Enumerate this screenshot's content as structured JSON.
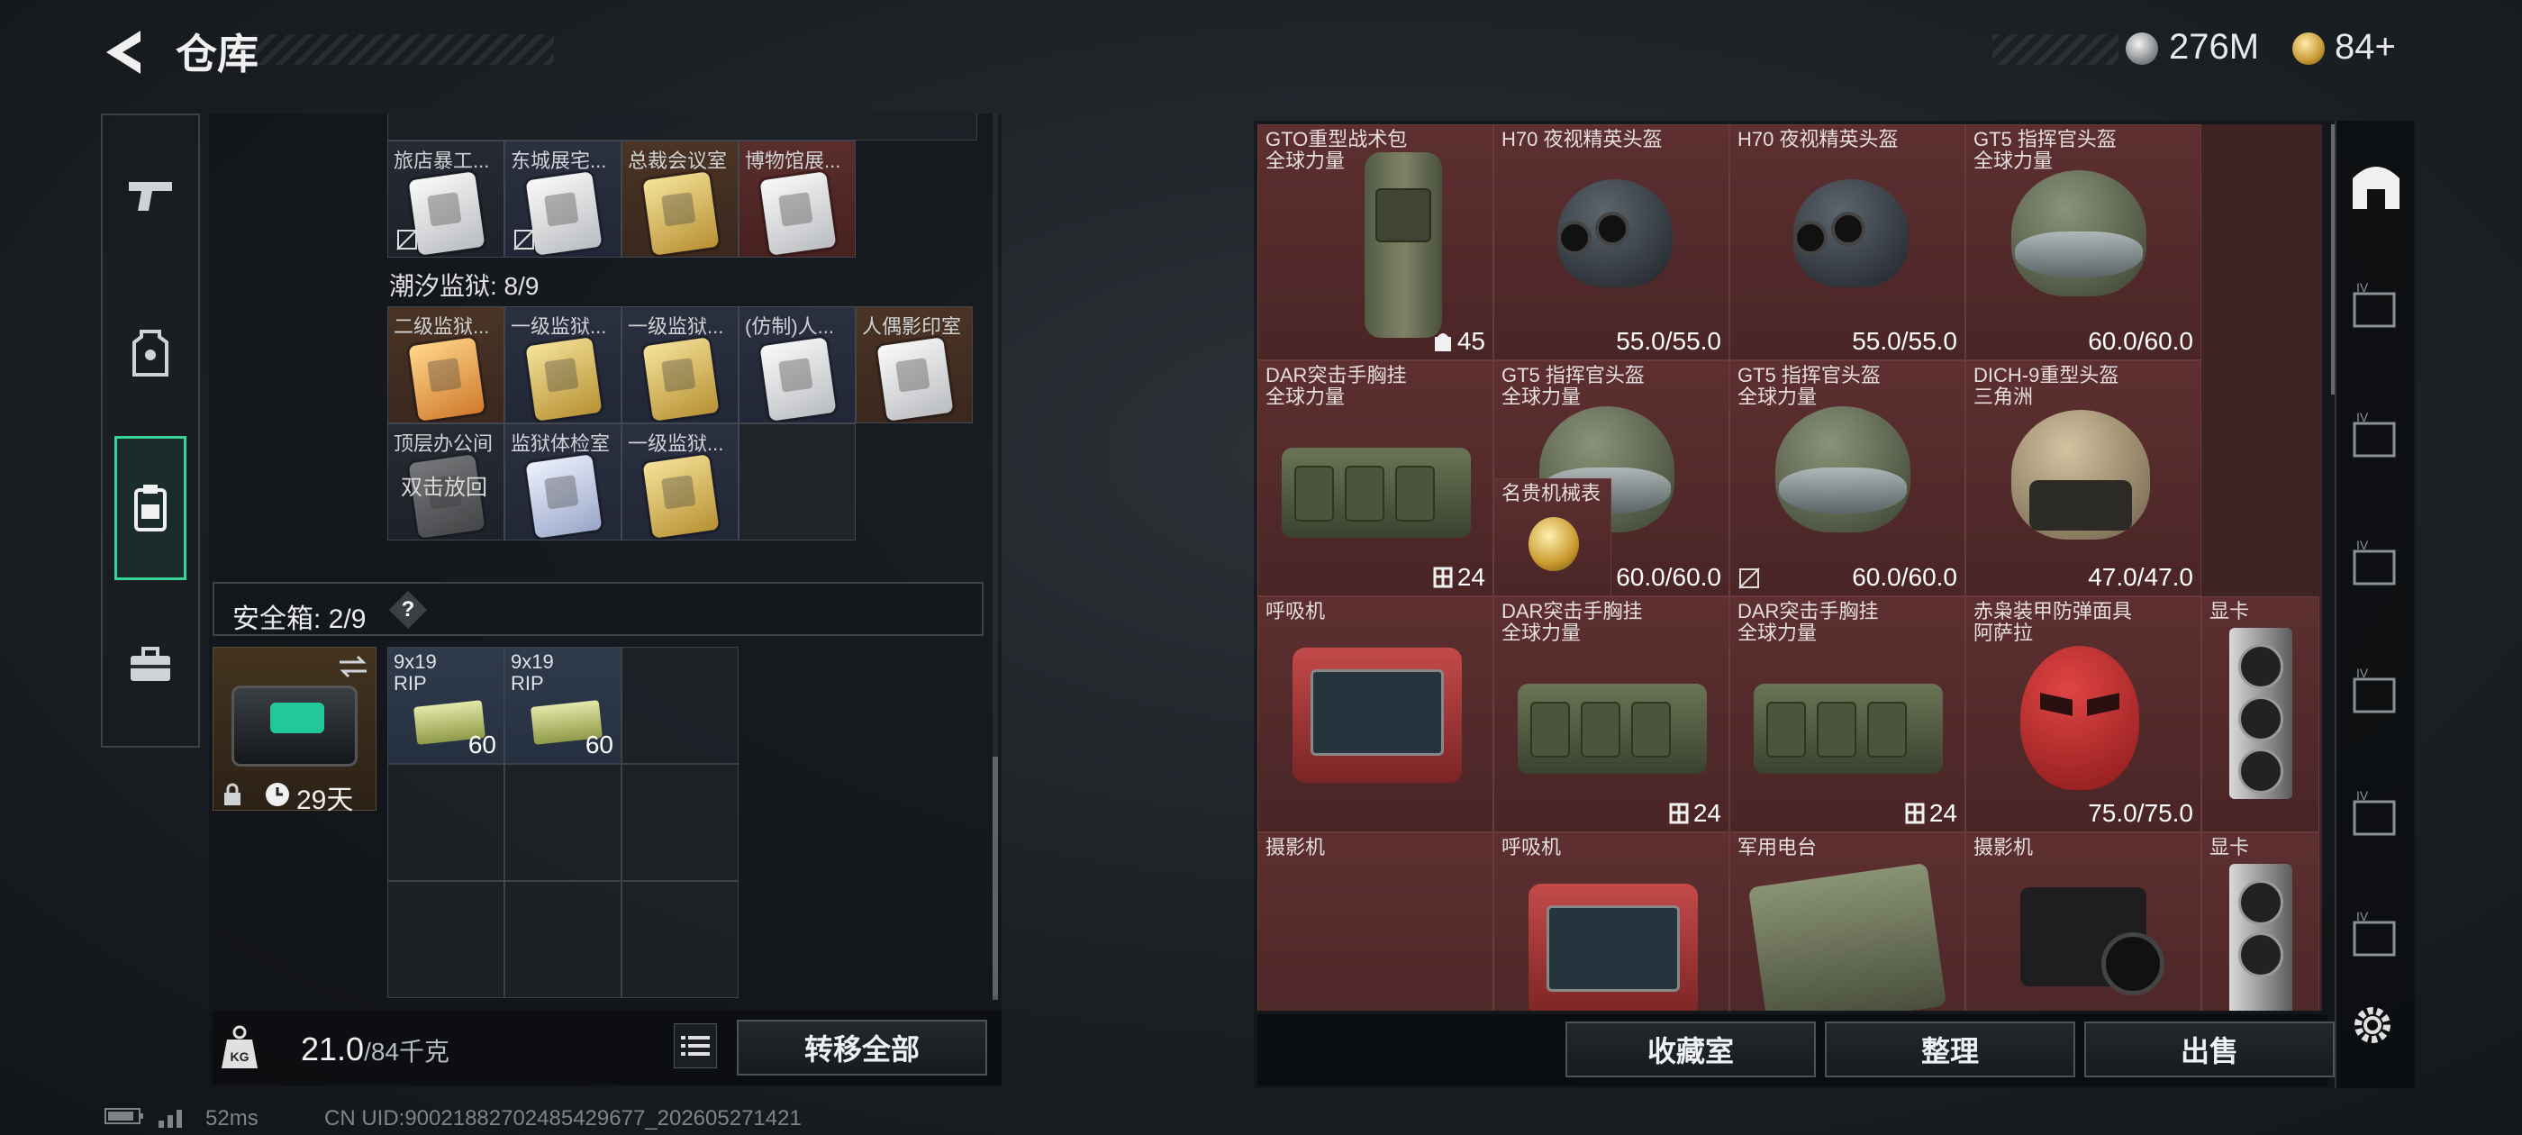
{
  "header": {
    "title": "仓库",
    "currency_silver": "276M",
    "currency_gold": "84+"
  },
  "collection": {
    "row1": [
      {
        "name": "旅店暴工..."
      },
      {
        "name": "东城展宅..."
      },
      {
        "name": "总裁会议室"
      },
      {
        "name": "博物馆展..."
      }
    ],
    "prison_label": "潮汐监狱: 8/9",
    "prison_row1": [
      {
        "name": "二级监狱..."
      },
      {
        "name": "一级监狱..."
      },
      {
        "name": "一级监狱..."
      },
      {
        "name": "(仿制)人..."
      },
      {
        "name": "人偶影印室"
      }
    ],
    "prison_row2": [
      {
        "name": "顶层办公间",
        "hint": "双击放回"
      },
      {
        "name": "监狱体检室"
      },
      {
        "name": "一级监狱..."
      }
    ]
  },
  "safe": {
    "label": "安全箱: 2/9",
    "help": "?",
    "days": "29天",
    "ammo": [
      {
        "name": "9x19\nRIP",
        "count": "60"
      },
      {
        "name": "9x19\nRIP",
        "count": "60"
      }
    ]
  },
  "weight": {
    "current": "21.0",
    "max": "/84千克"
  },
  "buttons": {
    "transfer_all": "转移全部",
    "collection_room": "收藏室",
    "organize": "整理",
    "sell": "出售"
  },
  "items": {
    "gto_bag": {
      "name": "GTO重型战术包",
      "sub": "全球力量",
      "cap": "45"
    },
    "h70_a": {
      "name": "H70 夜视精英头盔",
      "dur": "55.0/55.0"
    },
    "h70_b": {
      "name": "H70 夜视精英头盔",
      "dur": "55.0/55.0"
    },
    "gt5_a": {
      "name": "GT5 指挥官头盔",
      "sub": "全球力量",
      "dur": "60.0/60.0"
    },
    "gt5_b": {
      "name": "GT5 指挥官头盔",
      "sub": "全球力量",
      "dur": "60.0/60.0"
    },
    "gt5_c": {
      "name": "GT5 指挥官头盔",
      "sub": "全球力量",
      "dur": "60.0/60.0"
    },
    "dich9": {
      "name": "DICH-9重型头盔",
      "sub": "三角洲",
      "dur": "47.0/47.0"
    },
    "dar_a": {
      "name": "DAR突击手胸挂",
      "sub": "全球力量",
      "cap": "24"
    },
    "watch": {
      "name": "名贵机械表"
    },
    "dar_b": {
      "name": "DAR突击手胸挂",
      "sub": "全球力量",
      "cap": "24"
    },
    "dar_c": {
      "name": "DAR突击手胸挂",
      "sub": "全球力量",
      "cap": "24"
    },
    "red_mask": {
      "name": "赤枭装甲防弹面具",
      "sub": "阿萨拉",
      "dur": "75.0/75.0"
    },
    "gpu_a": {
      "name": "显卡"
    },
    "resp_a": {
      "name": "呼吸机"
    },
    "resp_b": {
      "name": "呼吸机"
    },
    "radio": {
      "name": "军用电台"
    },
    "camera_a": {
      "name": "摄影机"
    },
    "gpu_b": {
      "name": "显卡"
    },
    "camera_b": {
      "name": "摄影机"
    }
  },
  "footer": {
    "ping": "52ms",
    "uid": "CN UID:90021882702485429677_202605271421"
  },
  "colors": {
    "accent": "#37d39a",
    "item_red": "#5d2f30"
  }
}
